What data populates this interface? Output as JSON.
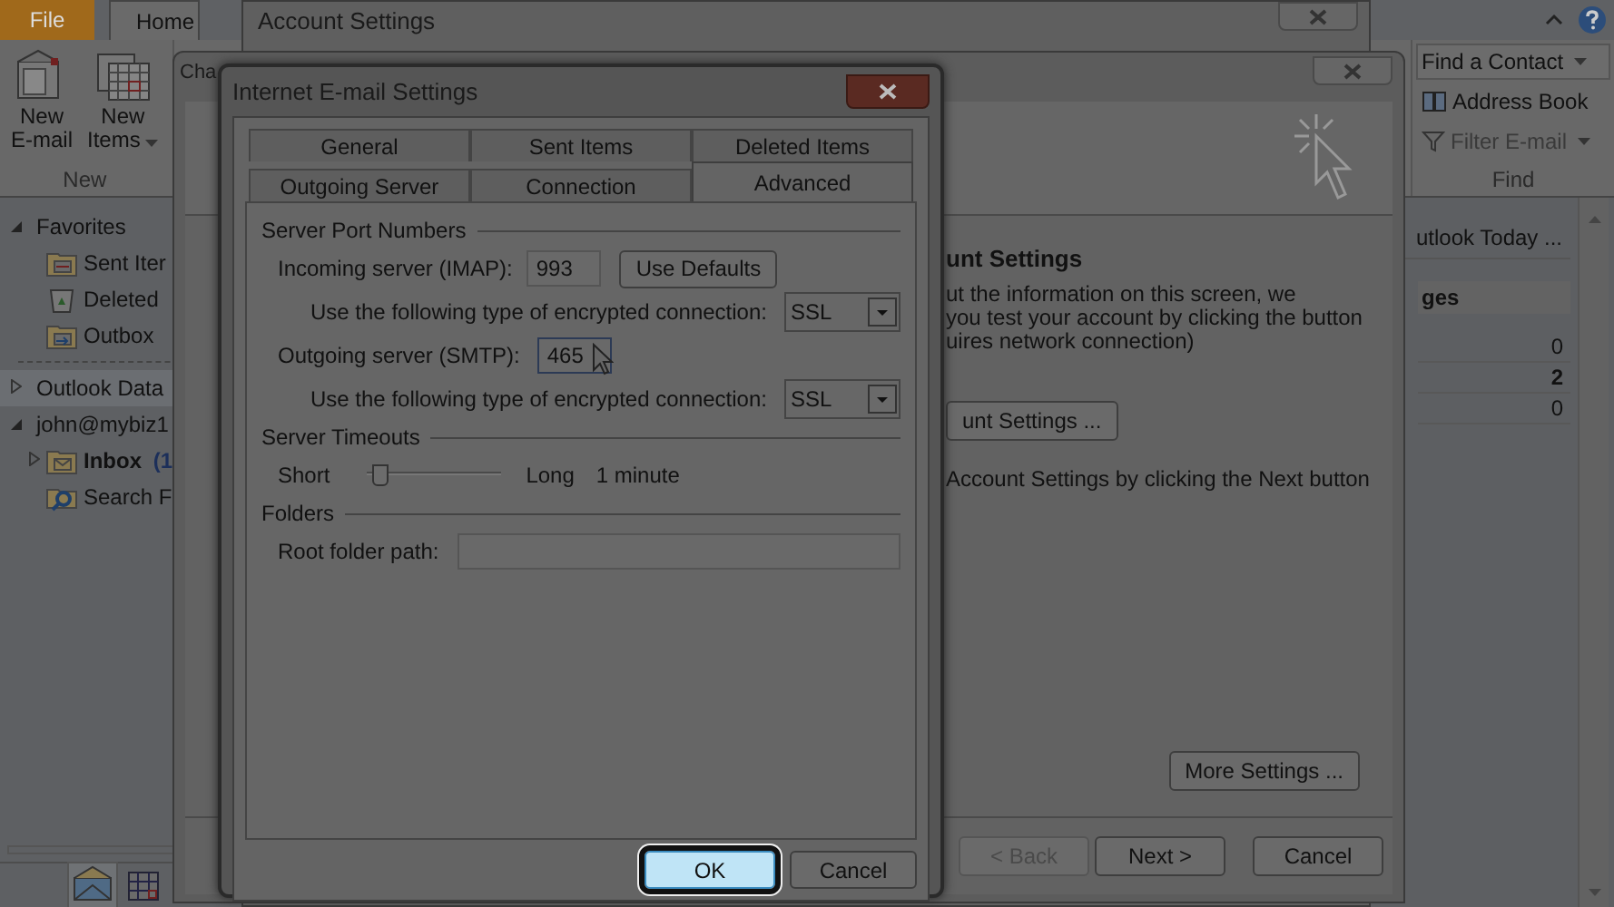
{
  "ribbon": {
    "tabs": [
      {
        "label": "File",
        "kind": "file",
        "selected": false
      },
      {
        "label": "Home",
        "kind": "tab",
        "selected": true
      }
    ],
    "new_buttons": [
      {
        "line1": "New",
        "line2": "E-mail",
        "kind": "mail",
        "dropdown": false
      },
      {
        "line1": "New",
        "line2": "Items",
        "kind": "items",
        "dropdown": true
      }
    ],
    "new_group_label": "New",
    "find_items": [
      {
        "label": "Find a Contact",
        "kind": "contact",
        "dropdown": true,
        "disabled": false
      },
      {
        "label": "Address Book",
        "kind": "book",
        "dropdown": false,
        "disabled": false
      },
      {
        "label": "Filter E-mail",
        "kind": "filter",
        "dropdown": true,
        "disabled": true
      }
    ],
    "find_group_label": "Find"
  },
  "folders": [
    {
      "label": "Favorites",
      "expanded": true,
      "selected": false,
      "children": [
        {
          "label": "Sent Iter",
          "kind": "sent",
          "selected": false
        },
        {
          "label": "Deleted",
          "kind": "deleted",
          "selected": false
        },
        {
          "label": "Outbox",
          "kind": "outbox",
          "selected": false
        }
      ]
    },
    {
      "label": "Outlook Data",
      "expanded": false,
      "selected": true
    },
    {
      "label": "john@mybiz1",
      "expanded": true,
      "selected": false,
      "children": [
        {
          "label": "Inbox",
          "count": "(1",
          "kind": "inbox",
          "expanded": false,
          "selected": false
        },
        {
          "label": "Search F",
          "kind": "search",
          "selected": false
        }
      ]
    }
  ],
  "today_pane": {
    "title": "utlook Today ...",
    "section": "ges",
    "counts": [
      {
        "value": "0",
        "bold": false
      },
      {
        "value": "2",
        "bold": true
      },
      {
        "value": "0",
        "bold": false
      }
    ]
  },
  "account_settings_window": {
    "title": "Account Settings"
  },
  "change_account_window": {
    "title": "Cha",
    "heading": "unt Settings",
    "paragraph_lines": [
      "ut the information on this screen, we",
      "you test your account by clicking the button",
      "uires network connection)"
    ],
    "test_button": "unt Settings ...",
    "next_hint": "Account Settings by clicking the Next button",
    "more_settings": "More Settings ...",
    "buttons": [
      {
        "label": "< Back",
        "disabled": true
      },
      {
        "label": "Next >",
        "disabled": false
      },
      {
        "label": "Cancel",
        "disabled": false
      }
    ]
  },
  "dialog": {
    "title": "Internet E-mail Settings",
    "tab_rows": [
      [
        {
          "label": "General",
          "selected": false
        },
        {
          "label": "Sent Items",
          "selected": false
        },
        {
          "label": "Deleted Items",
          "selected": false
        }
      ],
      [
        {
          "label": "Outgoing Server",
          "selected": false
        },
        {
          "label": "Connection",
          "selected": false
        },
        {
          "label": "Advanced",
          "selected": true
        }
      ]
    ],
    "server_ports": {
      "label": "Server Port Numbers",
      "incoming": {
        "label": "Incoming server (IMAP):",
        "value": "993",
        "focused": false
      },
      "use_defaults": "Use Defaults",
      "incoming_encryption": {
        "label": "Use the following type of encrypted connection:",
        "value": "SSL"
      },
      "outgoing": {
        "label": "Outgoing server (SMTP):",
        "value": "465",
        "focused": true
      },
      "outgoing_encryption": {
        "label": "Use the following type of encrypted connection:",
        "value": "SSL"
      }
    },
    "timeouts": {
      "label": "Server Timeouts",
      "short": "Short",
      "long": "Long",
      "level": 0.05,
      "reading": "1 minute"
    },
    "folders": {
      "label": "Folders",
      "root_label": "Root folder path:"
    },
    "buttons": [
      {
        "label": "OK",
        "highlighted": true
      },
      {
        "label": "Cancel",
        "highlighted": false
      }
    ]
  }
}
